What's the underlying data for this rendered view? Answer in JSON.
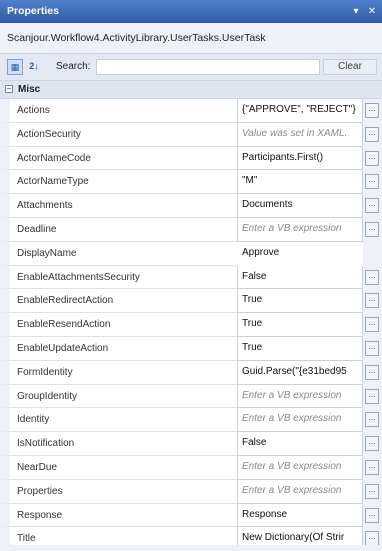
{
  "window": {
    "title": "Properties",
    "pin_glyph": "▾",
    "close_glyph": "✕"
  },
  "type_name": "Scanjour.Workflow4.ActivityLibrary.UserTasks.UserTask",
  "toolbar": {
    "categorized_glyph": "▦",
    "alphabetical_glyph": "2↓",
    "search_label": "Search:",
    "search_value": "",
    "clear_label": "Clear"
  },
  "category": {
    "toggle_glyph": "−",
    "label": "Misc"
  },
  "properties": [
    {
      "name": "Actions",
      "value": "{\"APPROVE\", \"REJECT\"}",
      "expr": false,
      "button": true
    },
    {
      "name": "ActionSecurity",
      "value": "Value was set in XAML.",
      "expr": true,
      "button": true
    },
    {
      "name": "ActorNameCode",
      "value": "Participants.First()",
      "expr": false,
      "button": true
    },
    {
      "name": "ActorNameType",
      "value": "\"M\"",
      "expr": false,
      "button": true
    },
    {
      "name": "Attachments",
      "value": "Documents",
      "expr": false,
      "button": true
    },
    {
      "name": "Deadline",
      "value": "Enter a VB expression",
      "expr": true,
      "button": true
    },
    {
      "name": "DisplayName",
      "value": "Approve",
      "expr": false,
      "button": false
    },
    {
      "name": "EnableAttachmentsSecurity",
      "value": "False",
      "expr": false,
      "button": true
    },
    {
      "name": "EnableRedirectAction",
      "value": "True",
      "expr": false,
      "button": true
    },
    {
      "name": "EnableResendAction",
      "value": "True",
      "expr": false,
      "button": true
    },
    {
      "name": "EnableUpdateAction",
      "value": "True",
      "expr": false,
      "button": true
    },
    {
      "name": "FormIdentity",
      "value": "Guid.Parse(\"{e31bed95",
      "expr": false,
      "button": true
    },
    {
      "name": "GroupIdentity",
      "value": "Enter a VB expression",
      "expr": true,
      "button": true
    },
    {
      "name": "Identity",
      "value": "Enter a VB expression",
      "expr": true,
      "button": true
    },
    {
      "name": "IsNotification",
      "value": "False",
      "expr": false,
      "button": true
    },
    {
      "name": "NearDue",
      "value": "Enter a VB expression",
      "expr": true,
      "button": true
    },
    {
      "name": "Properties",
      "value": "Enter a VB expression",
      "expr": true,
      "button": true
    },
    {
      "name": "Response",
      "value": "Response",
      "expr": false,
      "button": true
    },
    {
      "name": "Title",
      "value": "New Dictionary(Of Strir",
      "expr": false,
      "button": true
    }
  ],
  "ellipsis_label": "..."
}
